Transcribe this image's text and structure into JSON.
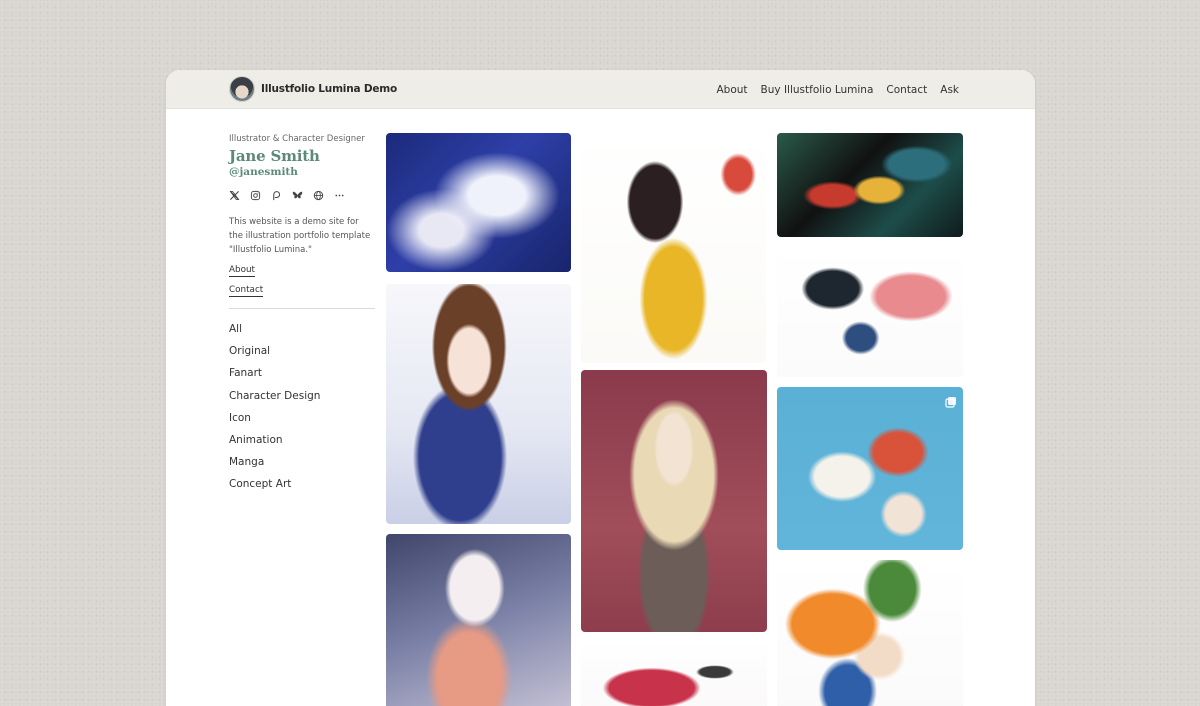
{
  "header": {
    "site_title": "Illustfolio Lumina Demo",
    "nav": [
      "About",
      "Buy Illustfolio Lumina",
      "Contact",
      "Ask"
    ]
  },
  "profile": {
    "role": "Illustrator & Character Designer",
    "name": "Jane Smith",
    "handle": "@janesmith",
    "bio": "This website is a demo site for the illustration portfolio template \"Illustfolio Lumina.\"",
    "links": [
      "About",
      "Contact"
    ],
    "socials": [
      "x-icon",
      "instagram-icon",
      "patreon-icon",
      "bluesky-icon",
      "globe-icon",
      "more-icon"
    ]
  },
  "categories": [
    "All",
    "Original",
    "Fanart",
    "Character Design",
    "Icon",
    "Animation",
    "Manga",
    "Concept Art"
  ],
  "colors": {
    "accent": "#5b8a76",
    "topbar": "#efede7",
    "page_bg": "#d9d5d0"
  }
}
